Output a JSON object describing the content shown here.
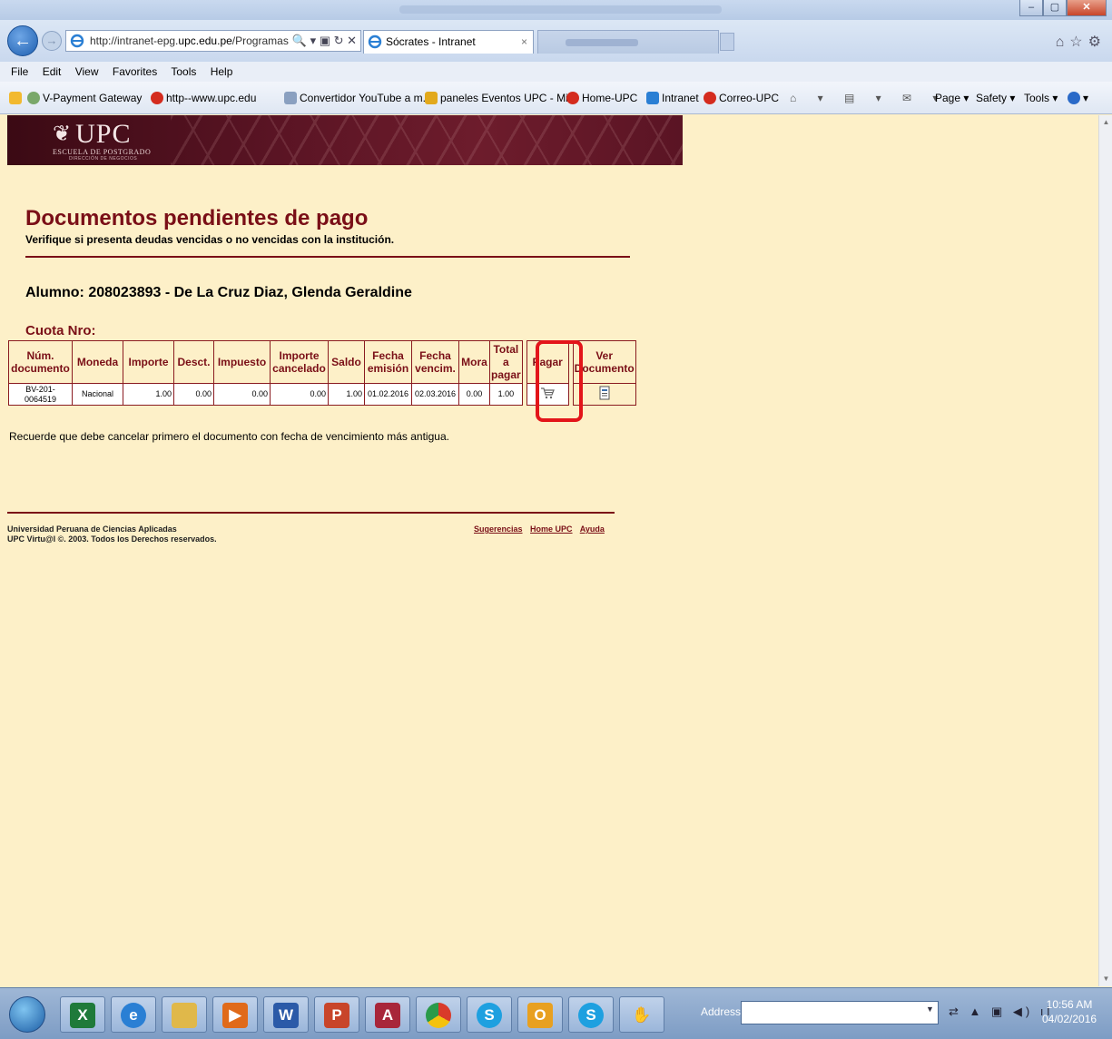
{
  "browser": {
    "address": "http://intranet-epg.upc.edu.pe/Programas",
    "address_domain_prefix": "http://intranet-epg.",
    "address_domain_bold": "upc.edu.pe",
    "address_suffix": "/Programas",
    "active_tab_title": "Sócrates - Intranet",
    "menu": [
      "File",
      "Edit",
      "View",
      "Favorites",
      "Tools",
      "Help"
    ],
    "favorites": [
      "V-Payment Gateway",
      "http--www.upc.edu",
      "Convertidor YouTube a m...",
      "paneles Eventos UPC - Mi...",
      "Home-UPC",
      "Intranet",
      "Correo-UPC"
    ],
    "command_bar": [
      "Page ▾",
      "Safety ▾",
      "Tools ▾"
    ]
  },
  "banner": {
    "logo": "UPC",
    "subtitle": "ESCUELA DE POSTGRADO",
    "subtitle2": "DIRECCIÓN DE NEGOCIOS"
  },
  "page": {
    "heading": "Documentos pendientes de pago",
    "subheading": "Verifique si presenta deudas vencidas o no vencidas con la institución.",
    "student": "Alumno: 208023893 - De La Cruz Diaz, Glenda Geraldine",
    "cuota_label": "Cuota Nro:",
    "note": "Recuerde que debe cancelar primero el documento con fecha de vencimiento más antigua."
  },
  "table": {
    "headers": [
      "Núm. documento",
      "Moneda",
      "Importe",
      "Desct.",
      "Impuesto",
      "Importe cancelado",
      "Saldo",
      "Fecha emisión",
      "Fecha vencim.",
      "Mora",
      "Total a pagar",
      "Pagar",
      "Ver Documento"
    ],
    "rows": [
      {
        "doc": "BV-201-0064519",
        "moneda": "Nacional",
        "importe": "1.00",
        "descuento": "0.00",
        "impuesto": "0.00",
        "cancelado": "0.00",
        "saldo": "1.00",
        "emision": "01.02.2016",
        "vencimiento": "02.03.2016",
        "mora": "0.00",
        "total": "1.00"
      }
    ]
  },
  "footer": {
    "org": "Universidad Peruana de Ciencias Aplicadas",
    "copyright": "UPC Virtu@l ©. 2003. Todos los Derechos reservados.",
    "links": [
      "Sugerencias",
      "Home UPC",
      "Ayuda"
    ]
  },
  "taskbar": {
    "address_label": "Address",
    "time": "10:56 AM",
    "date": "04/02/2016"
  }
}
